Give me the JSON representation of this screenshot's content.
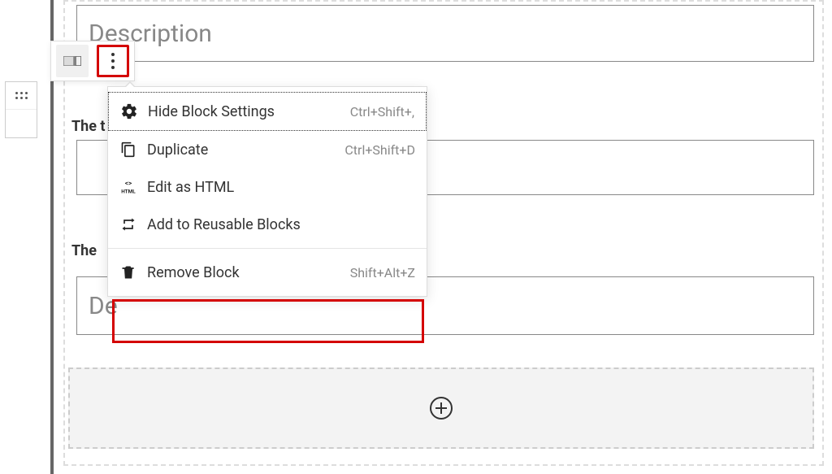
{
  "fields": {
    "description_placeholder": "Description",
    "label_1": "The t",
    "label_2": "The",
    "field3_placeholder": "De"
  },
  "menu": {
    "hide_settings": {
      "label": "Hide Block Settings",
      "shortcut": "Ctrl+Shift+,"
    },
    "duplicate": {
      "label": "Duplicate",
      "shortcut": "Ctrl+Shift+D"
    },
    "edit_html": {
      "label": "Edit as HTML"
    },
    "add_reusable": {
      "label": "Add to Reusable Blocks"
    },
    "remove": {
      "label": "Remove Block",
      "shortcut": "Shift+Alt+Z"
    }
  }
}
